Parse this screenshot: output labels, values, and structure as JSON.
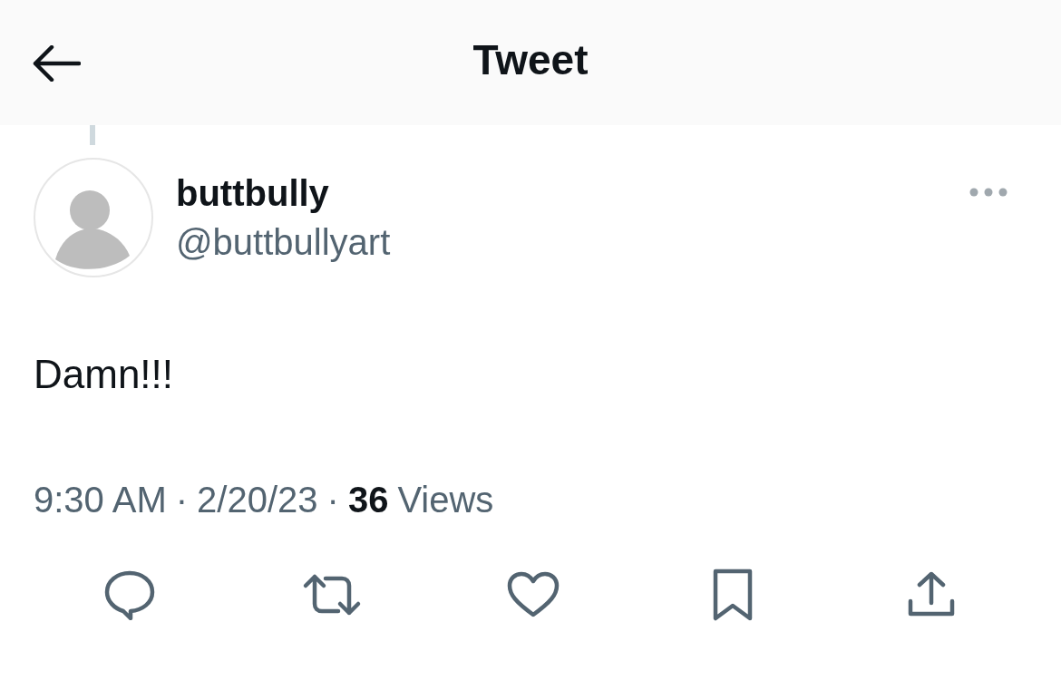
{
  "header": {
    "title": "Tweet"
  },
  "tweet": {
    "name": "buttbully",
    "handle": "@buttbullyart",
    "text": "Damn!!!",
    "meta": [
      {
        "kind": "plain",
        "text": "9:30 AM"
      },
      {
        "kind": "sep",
        "text": "·"
      },
      {
        "kind": "plain",
        "text": "2/20/23"
      },
      {
        "kind": "sep",
        "text": "·"
      },
      {
        "kind": "strong",
        "text": "36"
      },
      {
        "kind": "plain",
        "text": "Views"
      }
    ]
  }
}
